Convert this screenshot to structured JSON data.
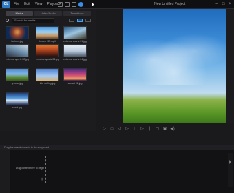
{
  "app": {
    "logo": "CL",
    "menu": [
      "File",
      "Edit",
      "View",
      "Playback"
    ],
    "project_title": "New Untitled Project",
    "window_controls": [
      "–",
      "□",
      "×"
    ]
  },
  "library": {
    "tabs": [
      "Media",
      "Video/Audio",
      "Transitions"
    ],
    "search_placeholder": "Search for media",
    "items": [
      {
        "label": "balloon.jpg",
        "thumb": "t-balloon"
      },
      {
        "label": "beach HD.mp4",
        "thumb": "t-beach"
      },
      {
        "label": "extreme sports 01.jpg",
        "thumb": "t-sport01"
      },
      {
        "label": "extreme sports 02.jpg",
        "thumb": "t-sport02"
      },
      {
        "label": "extreme sports 03.jpg",
        "thumb": "t-sport03"
      },
      {
        "label": "extreme sports 04.jpg",
        "thumb": "t-sport04"
      },
      {
        "label": "ground.jpg",
        "thumb": "t-ground"
      },
      {
        "label": "kite surfing.jpg",
        "thumb": "t-kite"
      },
      {
        "label": "sunset 01.jpg",
        "thumb": "t-sunset"
      },
      {
        "label": "sunlit.jpg",
        "thumb": "t-sunlit"
      }
    ]
  },
  "player": {
    "controls": [
      "▷",
      "□",
      "◁",
      "▷",
      "↑",
      "▷",
      "|",
      "▢",
      "▣",
      "◀)"
    ]
  },
  "timeline": {
    "hint": "Drag the selected media to the storyboard.",
    "drop_text": "Drag content here to begin",
    "drop_plus": "+"
  }
}
